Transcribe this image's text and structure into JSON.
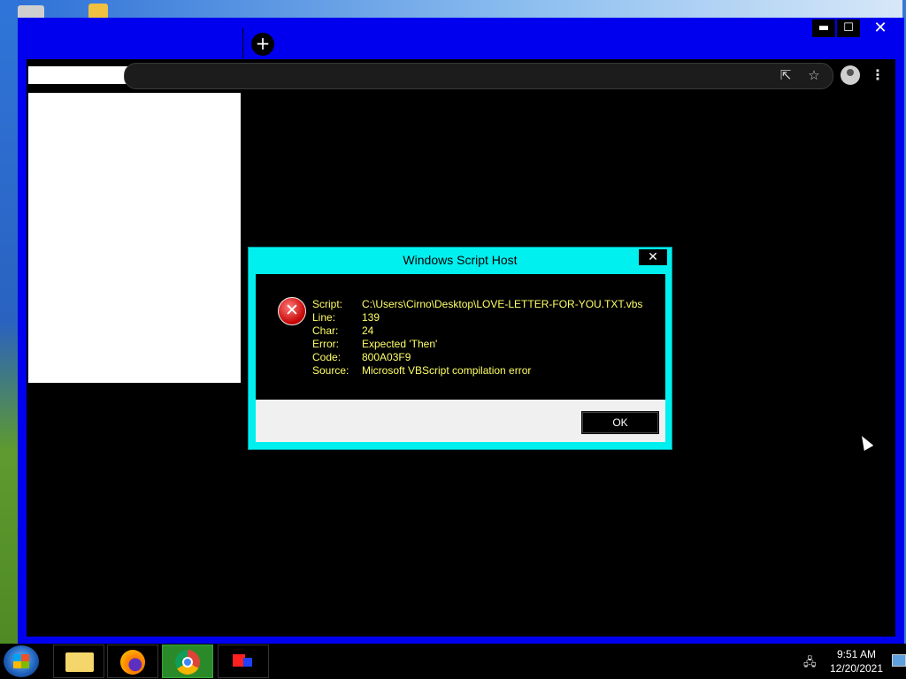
{
  "browser": {
    "new_tab_symbol": "+",
    "window_controls": {
      "minimize": "▬",
      "maximize": "☐",
      "close": "✕"
    },
    "toolbar_icons": [
      "share-icon",
      "star-icon",
      "profile-icon",
      "menu-icon"
    ],
    "menu_glyph": "⋮"
  },
  "dialog": {
    "title": "Windows Script Host",
    "close_glyph": "✕",
    "icon": "error-icon",
    "fields": [
      {
        "key": "Script:",
        "value": "C:\\Users\\Cirno\\Desktop\\LOVE-LETTER-FOR-YOU.TXT.vbs"
      },
      {
        "key": "Line:",
        "value": "139"
      },
      {
        "key": "Char:",
        "value": "24"
      },
      {
        "key": "Error:",
        "value": "Expected 'Then'"
      },
      {
        "key": "Code:",
        "value": "800A03F9"
      },
      {
        "key": "Source:",
        "value": "Microsoft VBScript compilation error"
      }
    ],
    "ok_label": "OK"
  },
  "taskbar": {
    "items": [
      "windows-explorer-icon",
      "firefox-icon",
      "chrome-icon",
      "paint-icon"
    ],
    "active_item": "chrome-icon",
    "clock": {
      "time": "9:51 AM",
      "date": "12/20/2021"
    }
  },
  "colors": {
    "window_frame": "#0000ee",
    "dialog_frame": "#00f0f0",
    "dialog_text": "#ffff66"
  }
}
